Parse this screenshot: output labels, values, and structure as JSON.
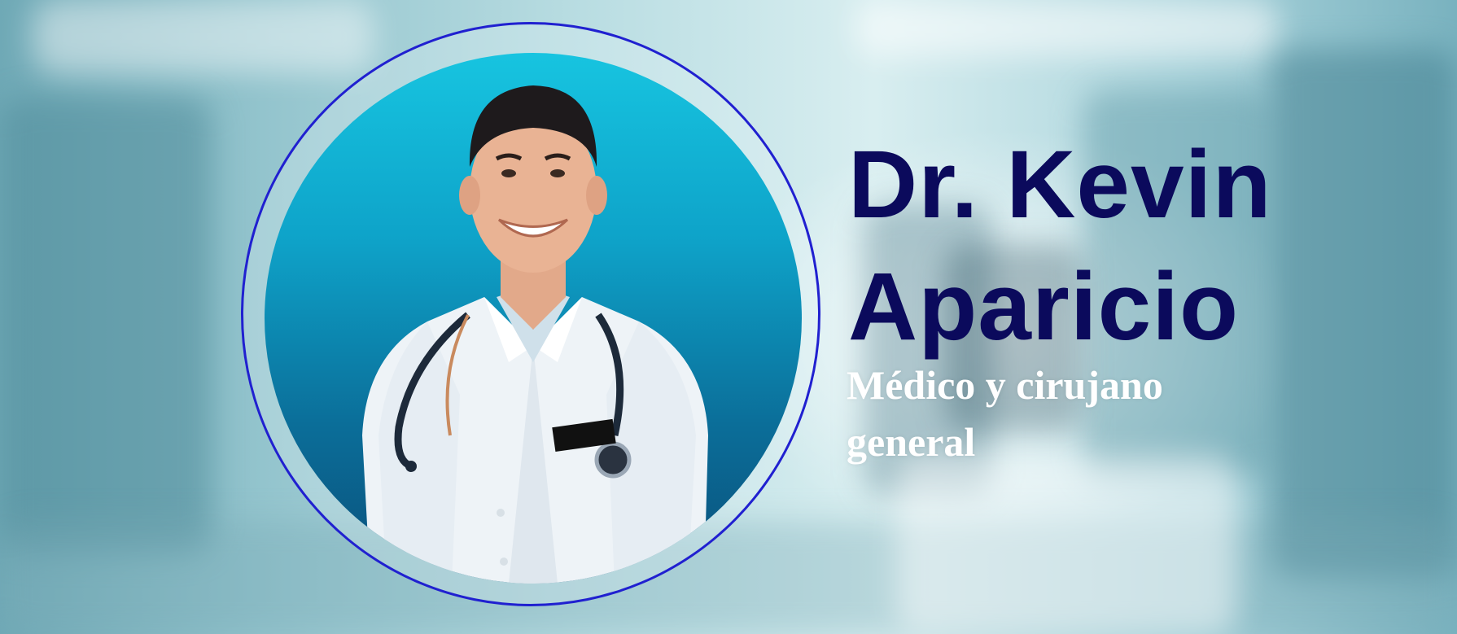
{
  "profile": {
    "name_line_1": "Dr. Kevin",
    "name_line_2": "Aparicio",
    "role_line_1": "Médico y cirujano",
    "role_line_2": "general"
  },
  "photo": {
    "subject": "smiling doctor in white coat with stethoscope"
  },
  "colors": {
    "name_text": "#0b0a5c",
    "role_text": "#ffffff",
    "ring": "#2020d0",
    "photo_background": "#17c4e0"
  }
}
